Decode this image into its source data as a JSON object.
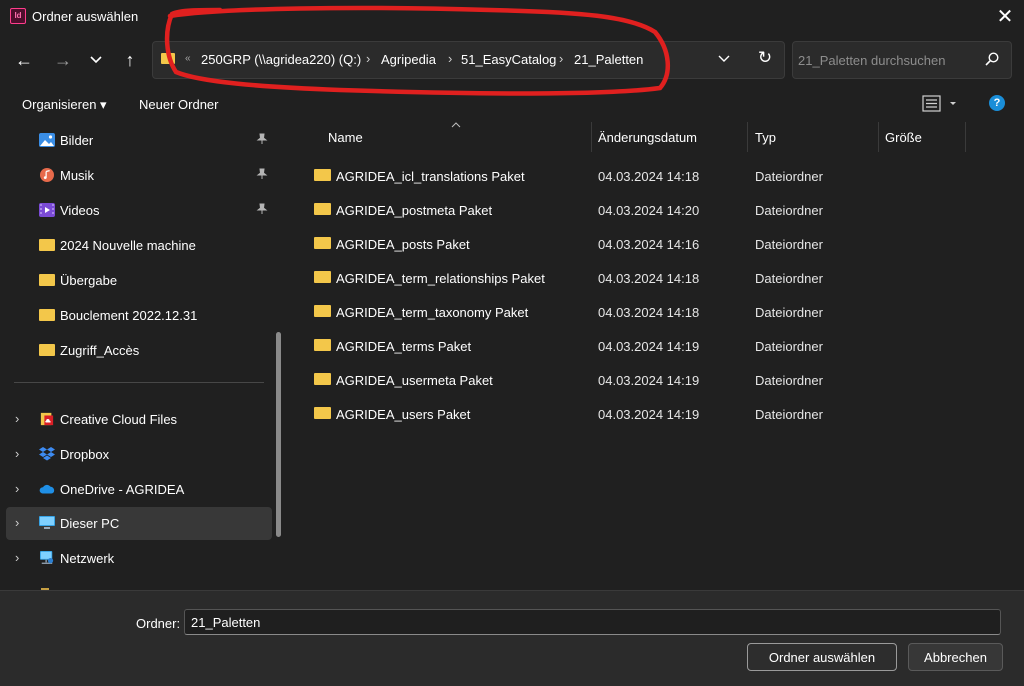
{
  "window": {
    "app_icon_text": "Id",
    "title": "Ordner auswählen",
    "close_glyph": "✕"
  },
  "nav": {
    "back_glyph": "←",
    "forward_glyph": "→",
    "recent_glyph": "⌄",
    "up_glyph": "↑"
  },
  "address": {
    "overflow": "«",
    "crumbs": [
      "250GRP (\\\\agridea220) (Q:)",
      "Agripedia",
      "51_EasyCatalog",
      "21_Paletten"
    ],
    "separator": "›",
    "dropdown_glyph": "⌄",
    "refresh_glyph": "↻"
  },
  "search": {
    "placeholder": "21_Paletten durchsuchen",
    "icon": "search-icon"
  },
  "toolbar": {
    "organize_label": "Organisieren ▾",
    "new_folder_label": "Neuer Ordner",
    "view_icon": "list-view-icon",
    "help_label": "?"
  },
  "sidebar": {
    "items": [
      {
        "label": "Bilder",
        "icon": "pictures-icon",
        "pinned": true
      },
      {
        "label": "Musik",
        "icon": "music-icon",
        "pinned": true
      },
      {
        "label": "Videos",
        "icon": "videos-icon",
        "pinned": true
      },
      {
        "label": "2024 Nouvelle machine",
        "icon": "folder-icon"
      },
      {
        "label": "Übergabe",
        "icon": "folder-icon"
      },
      {
        "label": "Bouclement 2022.12.31",
        "icon": "folder-icon"
      },
      {
        "label": "Zugriff_Accès",
        "icon": "folder-icon"
      },
      {
        "label": "Creative Cloud Files",
        "icon": "creative-cloud-icon"
      },
      {
        "label": "Dropbox",
        "icon": "dropbox-icon"
      },
      {
        "label": "OneDrive - AGRIDEA",
        "icon": "onedrive-icon"
      },
      {
        "label": "Dieser PC",
        "icon": "pc-icon",
        "selected": true
      },
      {
        "label": "Netzwerk",
        "icon": "network-icon"
      }
    ],
    "pin_glyph": "📌",
    "expand_glyph": "›"
  },
  "columns": {
    "name": "Name",
    "date": "Änderungsdatum",
    "type": "Typ",
    "size": "Größe"
  },
  "files": [
    {
      "name": "AGRIDEA_icl_translations Paket",
      "date": "04.03.2024 14:18",
      "type": "Dateiordner"
    },
    {
      "name": "AGRIDEA_postmeta Paket",
      "date": "04.03.2024 14:20",
      "type": "Dateiordner"
    },
    {
      "name": "AGRIDEA_posts Paket",
      "date": "04.03.2024 14:16",
      "type": "Dateiordner"
    },
    {
      "name": "AGRIDEA_term_relationships Paket",
      "date": "04.03.2024 14:18",
      "type": "Dateiordner"
    },
    {
      "name": "AGRIDEA_term_taxonomy Paket",
      "date": "04.03.2024 14:18",
      "type": "Dateiordner"
    },
    {
      "name": "AGRIDEA_terms Paket",
      "date": "04.03.2024 14:19",
      "type": "Dateiordner"
    },
    {
      "name": "AGRIDEA_usermeta Paket",
      "date": "04.03.2024 14:19",
      "type": "Dateiordner"
    },
    {
      "name": "AGRIDEA_users Paket",
      "date": "04.03.2024 14:19",
      "type": "Dateiordner"
    }
  ],
  "footer": {
    "folder_label": "Ordner:",
    "folder_value": "21_Paletten",
    "select_label": "Ordner auswählen",
    "cancel_label": "Abbrechen"
  },
  "colors": {
    "background": "#202020",
    "folder": "#f3c74a",
    "annotation": "#e0201f",
    "help": "#1a8ed8"
  }
}
